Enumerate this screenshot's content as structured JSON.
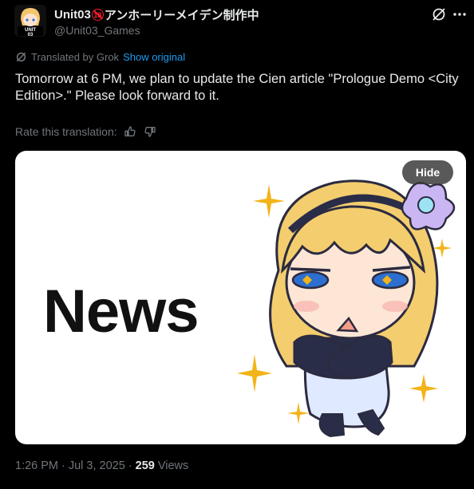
{
  "author": {
    "name": "Unit03",
    "badge": "18",
    "name_suffix": "アンホーリーメイデン制作中",
    "handle": "@Unit03_Games",
    "avatar_text": "UNIT 03"
  },
  "translation": {
    "label": "Translated by Grok",
    "show_original": "Show original"
  },
  "tweet": {
    "text": "Tomorrow at 6 PM, we plan to update the Cien article \"Prologue Demo <City Edition>.\" Please look forward to it."
  },
  "rating": {
    "label": "Rate this translation:"
  },
  "media": {
    "headline": "News",
    "hide_label": "Hide"
  },
  "meta": {
    "time": "1:26 PM",
    "separator": "·",
    "date": "Jul 3, 2025",
    "separator2": "·",
    "views_count": "259",
    "views_label": "Views"
  },
  "icons": {
    "grok": "grok-icon",
    "more": "more-icon",
    "thumbs_up": "thumbs-up-icon",
    "thumbs_down": "thumbs-down-icon"
  },
  "colors": {
    "background": "#000000",
    "text": "#e7e9ea",
    "muted": "#71767b",
    "link": "#1d9bf0",
    "age_badge": "#f4212e"
  }
}
